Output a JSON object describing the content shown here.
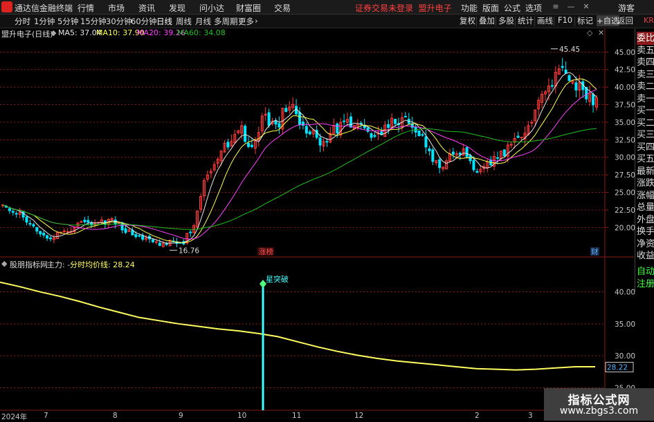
{
  "topbar": {
    "app_title": "通达信金融终端",
    "menu": [
      "行情",
      "市场",
      "资讯",
      "发现",
      "问小达",
      "财富圈",
      "交易"
    ],
    "warning": "证券交易未登录",
    "stock_name": "盟升电子",
    "right_menu": [
      "功能",
      "版面",
      "公式",
      "选项"
    ],
    "guest": "游客"
  },
  "toolbar": {
    "periods": [
      "分时",
      "1分钟",
      "5分钟",
      "15分钟",
      "30分钟",
      "60分钟",
      "日线",
      "周线",
      "月线",
      "多周期",
      "更多"
    ],
    "active_period": "日线",
    "right_buttons": [
      "复权",
      "叠加",
      "多股",
      "统计",
      "画线",
      "F10",
      "标记",
      "+自选",
      "返回"
    ]
  },
  "main_chart_info": {
    "title": "盟升电子(日线)",
    "ma5": "MA5: 37.04",
    "ma10": "MA10: 37.90",
    "ma20": "MA20: 39.26",
    "ma60": "MA60: 34.08"
  },
  "sub_chart_info": {
    "title": "股朋指标网",
    "main_label": "主力: -",
    "avg_line": "分时均价线: 28.24"
  },
  "right_panel": {
    "corner": "KR",
    "items": [
      "委比",
      "卖五",
      "卖四",
      "卖三",
      "卖二",
      "卖一",
      "买一",
      "买二",
      "买三",
      "买四",
      "买五",
      "最新",
      "涨跌",
      "涨幅",
      "总量",
      "外盘",
      "换手",
      "净资",
      "收益"
    ],
    "bottom_items": [
      "自动",
      "注册"
    ]
  },
  "annotations": {
    "high": "45.45",
    "low": "16.76",
    "limit_up_tag": "涨榜",
    "finance_tag": "财",
    "signal": "星突破",
    "current_value": "28.22"
  },
  "date_axis": [
    "2024年",
    "7",
    "8",
    "9",
    "10",
    "11",
    "12",
    "2",
    "3"
  ],
  "watermark": {
    "line1": "指标公式网",
    "line2": "www.zbgs3.com"
  },
  "colors": {
    "up": "#ff3c3c",
    "down": "#00e5ff",
    "ma5": "#e8e8e8",
    "ma10": "#ffff50",
    "ma20": "#ff40ff",
    "ma60": "#20c020",
    "avg_line": "#ffff60",
    "signal": "#40ffff"
  },
  "chart_data": [
    {
      "type": "candlestick",
      "title": "盟升电子(日线)",
      "y_ticks": [
        45,
        42.5,
        40,
        37.5,
        35,
        32.5,
        30,
        27.5,
        25,
        22.5,
        20
      ],
      "y_tick_labels": [
        "45.00",
        "42.50",
        "40.00",
        "37.50",
        "35.00",
        "32.50",
        "30.00",
        "27.50",
        "25.00",
        "22.50",
        "20.00"
      ],
      "ylim": [
        16,
        47
      ],
      "x_labels": [
        "2024年",
        "7",
        "8",
        "9",
        "10",
        "11",
        "12",
        "2",
        "3"
      ],
      "high": 45.45,
      "low": 16.76,
      "close_approx": [
        23,
        22.5,
        21,
        19.5,
        18.5,
        19.5,
        20,
        21,
        20.5,
        21,
        20,
        19,
        18.5,
        17.5,
        18,
        17.5,
        20,
        27,
        30,
        32,
        34,
        31.5,
        36,
        34,
        38,
        35,
        33.5,
        32,
        34,
        35,
        34.5,
        33,
        34,
        35.5,
        35,
        34,
        30,
        28.5,
        31,
        30.5,
        28,
        29,
        30.5,
        32,
        34,
        37,
        40,
        44,
        41,
        39,
        38
      ],
      "series": [
        {
          "name": "MA5",
          "value": 37.04
        },
        {
          "name": "MA10",
          "value": 37.9
        },
        {
          "name": "MA20",
          "value": 39.26
        },
        {
          "name": "MA60",
          "value": 34.08
        }
      ]
    },
    {
      "type": "line",
      "title": "股朋指标网",
      "y_ticks": [
        40,
        35,
        30,
        25
      ],
      "y_tick_labels": [
        "40.00",
        "35.00",
        "30.00",
        "25.00"
      ],
      "ylim": [
        21.5,
        43.5
      ],
      "series": [
        {
          "name": "分时均价线",
          "last": 28.24,
          "values": [
            41.5,
            40.8,
            40,
            39.3,
            38.5,
            37.6,
            36.8,
            36,
            35.5,
            35,
            34.6,
            34.2,
            33.9,
            33.5,
            33,
            32.2,
            31.4,
            30.7,
            30.1,
            29.6,
            29.2,
            28.9,
            28.6,
            28.3,
            28,
            27.9,
            27.8,
            27.9,
            28.1,
            28.3,
            28.3
          ]
        }
      ],
      "signal": {
        "label": "星突破",
        "x_index": 0.4348
      }
    }
  ]
}
